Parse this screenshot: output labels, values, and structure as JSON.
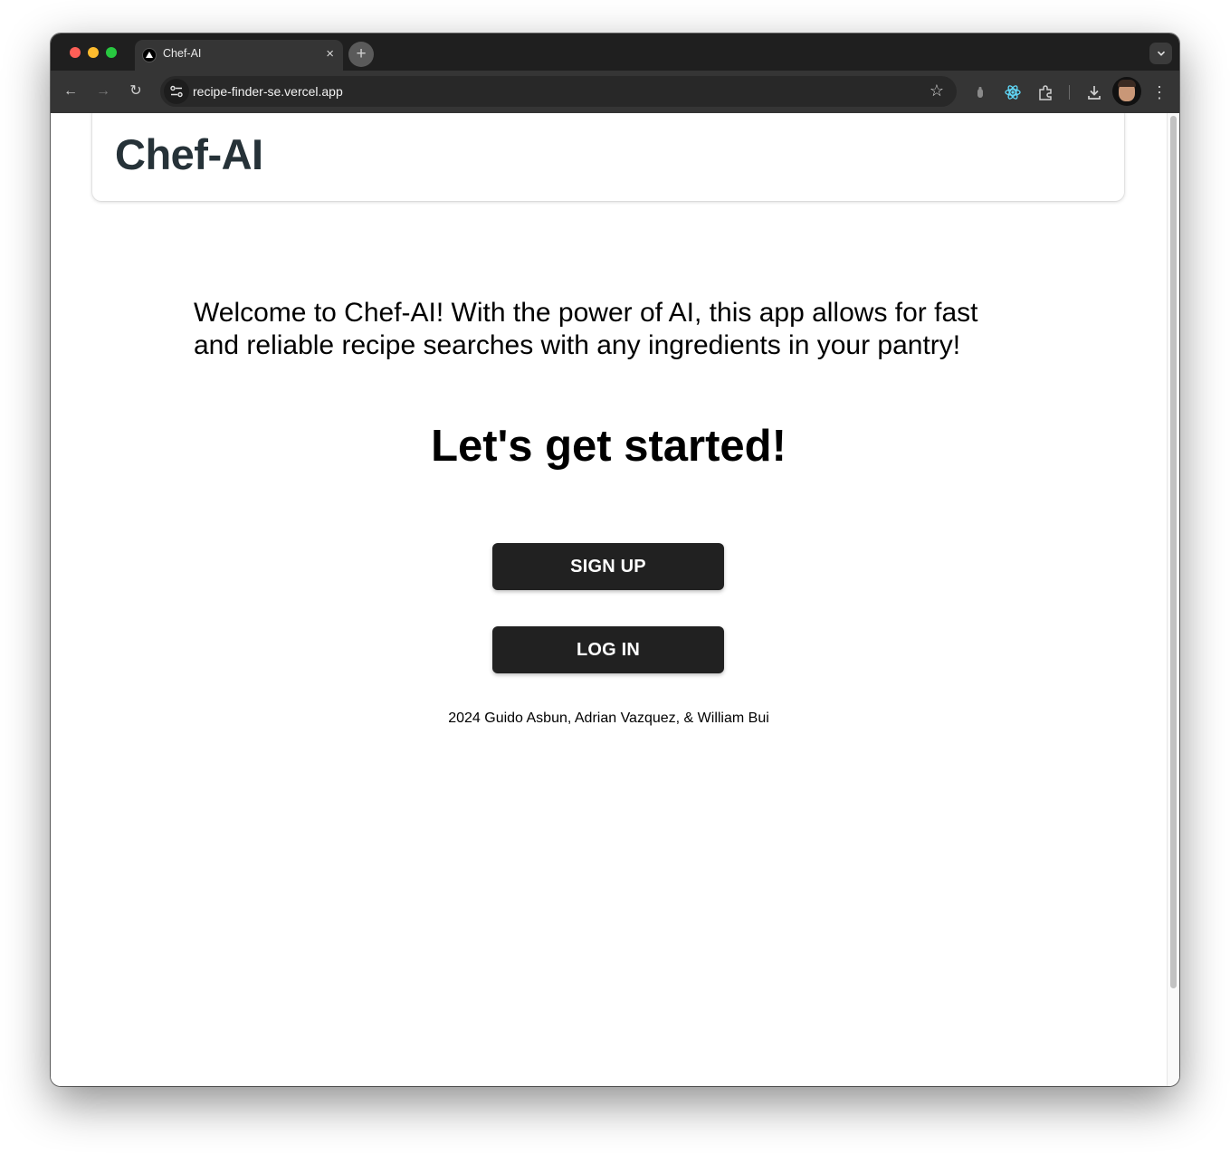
{
  "browser": {
    "tab": {
      "title": "Chef-AI",
      "close": "×"
    },
    "new_tab": "+",
    "tabs_menu": "⌄",
    "nav": {
      "back": "←",
      "forward": "→",
      "reload": "↻"
    },
    "address_bar": {
      "url": "recipe-finder-se.vercel.app",
      "bookmark": "☆"
    },
    "toolbar": {
      "menu": "⋮"
    }
  },
  "page": {
    "header": {
      "title": "Chef-AI"
    },
    "intro": "Welcome to Chef-AI! With the power of AI, this app allows for fast and reliable recipe searches with any ingredients in your pantry!",
    "cta_heading": "Let's get started!",
    "buttons": {
      "signup": "SIGN UP",
      "login": "LOG IN"
    },
    "footer": "2024 Guido Asbun, Adrian Vazquez, & William Bui"
  },
  "colors": {
    "chrome_dark": "#1f1f1f",
    "chrome_toolbar": "#353535",
    "button_bg": "#212121",
    "header_title": "#263238"
  },
  "icons": [
    "vercel-favicon-icon",
    "close-icon",
    "plus-icon",
    "chevron-down-icon",
    "back-arrow-icon",
    "forward-arrow-icon",
    "reload-icon",
    "site-info-icon",
    "star-icon",
    "extension-icon",
    "react-devtools-icon",
    "puzzle-icon",
    "download-icon",
    "profile-avatar",
    "more-vert-icon"
  ]
}
